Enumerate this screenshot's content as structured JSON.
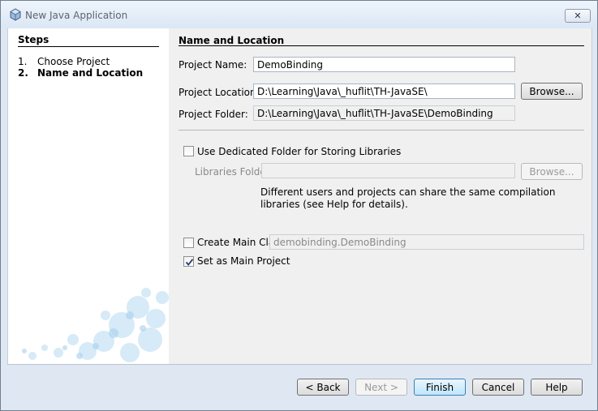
{
  "window": {
    "title": "New Java Application",
    "close_label": "✕"
  },
  "steps": {
    "heading": "Steps",
    "items": [
      {
        "num": "1.",
        "label": "Choose Project"
      },
      {
        "num": "2.",
        "label": "Name and Location"
      }
    ]
  },
  "form": {
    "heading": "Name and Location",
    "project_name_label": "Project Name:",
    "project_name_value": "DemoBinding",
    "project_location_label": "Project Location:",
    "project_location_value": "D:\\Learning\\Java\\_huflit\\TH-JavaSE\\",
    "project_folder_label": "Project Folder:",
    "project_folder_value": "D:\\Learning\\Java\\_huflit\\TH-JavaSE\\DemoBinding",
    "browse_label": "Browse...",
    "dedicated_folder_label": "Use Dedicated Folder for Storing Libraries",
    "dedicated_folder_checked": false,
    "libraries_folder_label": "Libraries Folder:",
    "libraries_folder_value": "",
    "libraries_browse_label": "Browse...",
    "share_note_line1": "Different users and projects can share the same compilation",
    "share_note_line2": "libraries (see Help for details).",
    "create_main_class_label": "Create Main Class",
    "create_main_class_checked": false,
    "main_class_value": "demobinding.DemoBinding",
    "set_main_project_label": "Set as Main Project",
    "set_main_project_checked": true
  },
  "buttons": {
    "back": "< Back",
    "next": "Next >",
    "finish": "Finish",
    "cancel": "Cancel",
    "help": "Help"
  }
}
